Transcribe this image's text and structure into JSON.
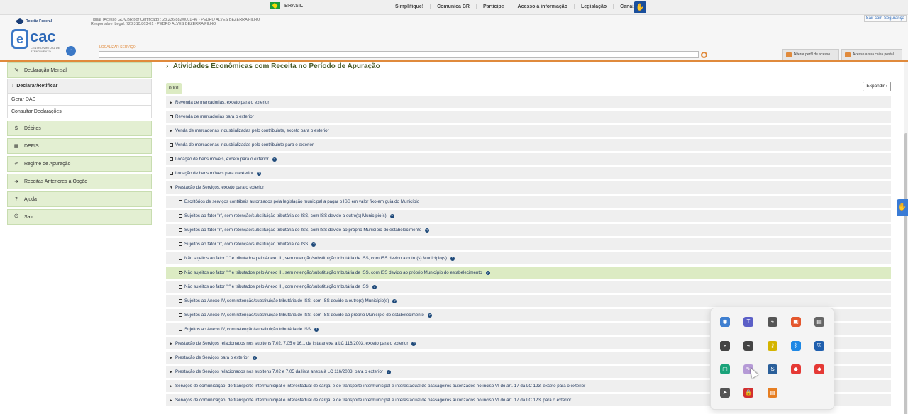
{
  "govbar": {
    "brasil": "BRASIL",
    "links": [
      "Simplifique!",
      "Comunica BR",
      "Participe",
      "Acesso à informação",
      "Legislação",
      "Canais"
    ]
  },
  "header": {
    "rf_logo": "Receita Federal",
    "ecac_letter": "e",
    "ecac_word": "cac",
    "ecac_sub": "CENTRO VIRTUAL DE ATENDIMENTO",
    "titular_line1": "Titular (Acesso GOV.BR por Certificado): 23.236.882/0001-46 - PEDRO ALVES BEZERRA FILHO",
    "titular_line2": "Responsável Legal: 723.310.863-01 - PEDRO ALVES BEZERRA FILHO",
    "sair": "Sair com Segurança",
    "localizar_label": "LOCALIZAR SERVIÇO",
    "search_value": "",
    "btn_perfil": "Alterar perfil de acesso",
    "btn_caixa": "Acesse a sua caixa postal"
  },
  "sidebar": {
    "declaracao_mensal": "Declaração Mensal",
    "declarar_retificar": "Declarar/Retificar",
    "gerar_das": "Gerar DAS",
    "consultar": "Consultar Declarações",
    "debitos": "Débitos",
    "defis": "DEFIS",
    "regime": "Regime de Apuração",
    "receitas": "Receitas Anteriores à Opção",
    "ajuda": "Ajuda",
    "sair": "Sair"
  },
  "main": {
    "title": "Atividades Econômicas com Receita no Período de Apuração",
    "establishment": "0001",
    "expand": "Expandir",
    "rows": [
      {
        "t": "Revenda de mercadorias, exceto para o exterior"
      },
      {
        "t": "Revenda de mercadorias para o exterior"
      },
      {
        "t": "Venda de mercadorias industrializadas pelo contribuinte, exceto para o exterior"
      },
      {
        "t": "Venda de mercadorias industrializadas pelo contribuinte para o exterior"
      },
      {
        "t": "Locação de bens móveis, exceto para o exterior"
      },
      {
        "t": "Locação de bens móveis para o exterior"
      },
      {
        "t": "Prestação de Serviços, exceto para o exterior"
      },
      {
        "t": "Escritórios de serviços contábeis autorizados pela legislação municipal a pagar o ISS em valor fixo em guia do Município"
      },
      {
        "t": "Sujeitos ao fator \"r\", sem retenção/substituição tributária de ISS, com ISS devido a outro(s) Município(s)"
      },
      {
        "t": "Sujeitos ao fator \"r\", sem retenção/substituição tributária de ISS, com ISS devido ao próprio Município do estabelecimento"
      },
      {
        "t": "Sujeitos ao fator \"r\", com retenção/substituição tributária de ISS"
      },
      {
        "t": "Não sujeitos ao fator \"r\" e tributados pelo Anexo III, sem retenção/substituição tributária de ISS, com ISS devido a outro(s) Município(s)"
      },
      {
        "t": "Não sujeitos ao fator \"r\" e tributados pelo Anexo III, sem retenção/substituição tributária de ISS, com ISS devido ao próprio Município do estabelecimento"
      },
      {
        "t": "Não sujeitos ao fator \"r\" e tributados pelo Anexo III, com retenção/substituição tributária de ISS"
      },
      {
        "t": "Sujeitos ao Anexo IV, sem retenção/substituição tributária de ISS, com ISS devido a outro(s) Município(s)"
      },
      {
        "t": "Sujeitos ao Anexo IV, sem retenção/substituição tributária de ISS, com ISS devido ao próprio Município do estabelecimento"
      },
      {
        "t": "Sujeitos ao Anexo IV, com retenção/substituição tributária de ISS"
      },
      {
        "t": "Prestação de Serviços relacionados nos subitens 7.02, 7.05 e 16.1 da lista anexa à LC 116/2003, exceto para o exterior"
      },
      {
        "t": "Prestação de Serviços para o exterior"
      },
      {
        "t": "Prestação de Serviços relacionados nos subitens 7.02 e 7.05 da lista anexa à LC 116/2003, para o exterior"
      },
      {
        "t": "Serviços de comunicação; de transporte intermunicipal e interestadual de carga; e de transporte intermunicipal e interestadual de passageiros autorizados no inciso VI do art. 17 da LC 123, exceto para o exterior"
      },
      {
        "t": "Serviços de comunicação; de transporte intermunicipal e interestadual de carga; e de transporte intermunicipal e interestadual de passageiros autorizados no inciso VI do art. 17 da LC 123, para o exterior"
      }
    ]
  },
  "colors": {
    "accent_orange": "#e08a3c",
    "side_green": "#e3efd2",
    "title_green": "#4a5b2a",
    "row_gray": "#efefef",
    "selected_green": "#dcebc3"
  }
}
